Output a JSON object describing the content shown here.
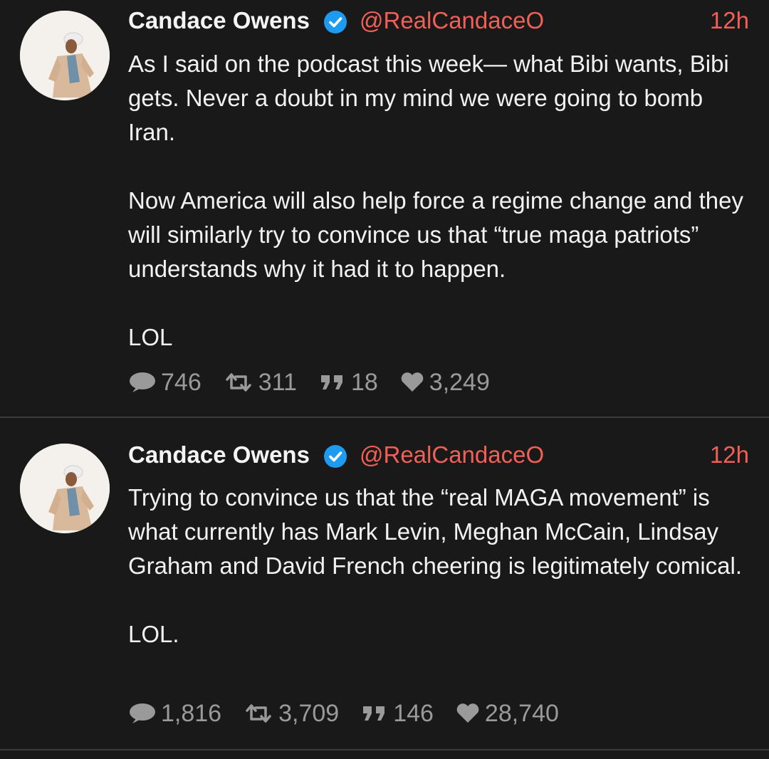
{
  "colors": {
    "background": "#191919",
    "accent": "#f25f57",
    "verified": "#1d9bf0",
    "stat_gray": "#9a9a9a",
    "divider": "#3a3a3a"
  },
  "tweets": [
    {
      "name": "Candace Owens",
      "handle": "@RealCandaceO",
      "time": "12h",
      "text": "As I said on the podcast this week— what Bibi wants, Bibi gets. Never a doubt in my mind we were going to bomb Iran.\n\nNow America will also help force a regime change and they will similarly try to convince us that “true maga patriots” understands why it had it to happen.\n\nLOL",
      "stats": {
        "replies": "746",
        "retweets": "311",
        "quotes": "18",
        "likes": "3,249"
      }
    },
    {
      "name": "Candace Owens",
      "handle": "@RealCandaceO",
      "time": "12h",
      "text": "Trying to convince us that the “real MAGA movement” is what currently has Mark Levin, Meghan McCain, Lindsay Graham and David French cheering is legitimately comical.\n\nLOL.",
      "stats": {
        "replies": "1,816",
        "retweets": "3,709",
        "quotes": "146",
        "likes": "28,740"
      }
    }
  ]
}
